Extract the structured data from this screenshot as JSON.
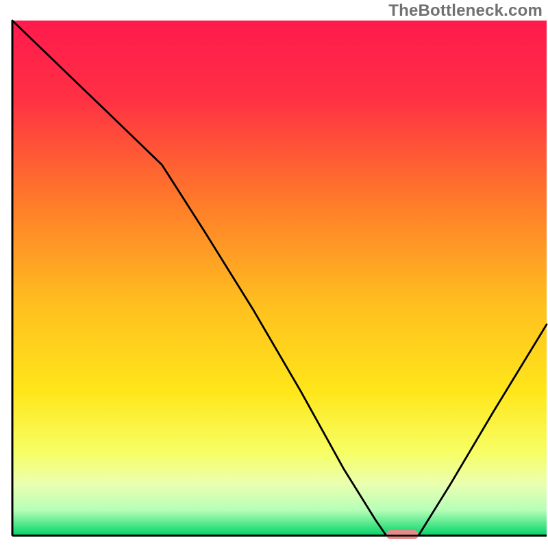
{
  "watermark": "TheBottleneck.com",
  "chart_data": {
    "type": "line",
    "title": "",
    "xlabel": "",
    "ylabel": "",
    "xlim": [
      0,
      100
    ],
    "ylim": [
      0,
      100
    ],
    "grid": false,
    "legend": false,
    "background_gradient_stops": [
      {
        "offset": 0.0,
        "color": "#ff1a4d"
      },
      {
        "offset": 0.15,
        "color": "#ff3044"
      },
      {
        "offset": 0.35,
        "color": "#ff7a2a"
      },
      {
        "offset": 0.55,
        "color": "#ffbf1f"
      },
      {
        "offset": 0.72,
        "color": "#ffe61a"
      },
      {
        "offset": 0.84,
        "color": "#f7ff66"
      },
      {
        "offset": 0.9,
        "color": "#eaffb0"
      },
      {
        "offset": 0.95,
        "color": "#b8ffb8"
      },
      {
        "offset": 1.0,
        "color": "#00d468"
      }
    ],
    "series": [
      {
        "name": "bottleneck-curve",
        "x": [
          0,
          5,
          10,
          16,
          22,
          28,
          36,
          45,
          54,
          62,
          68,
          70,
          73,
          76,
          82,
          90,
          100
        ],
        "y": [
          100,
          95,
          90,
          84,
          78,
          72,
          59,
          44,
          28,
          13,
          3,
          0,
          0,
          0,
          10,
          24,
          41
        ]
      }
    ],
    "marker": {
      "name": "optimal-marker",
      "x_start": 70,
      "x_end": 76,
      "y": 0,
      "color": "#e68a8a"
    },
    "axes_color": "#000000"
  }
}
